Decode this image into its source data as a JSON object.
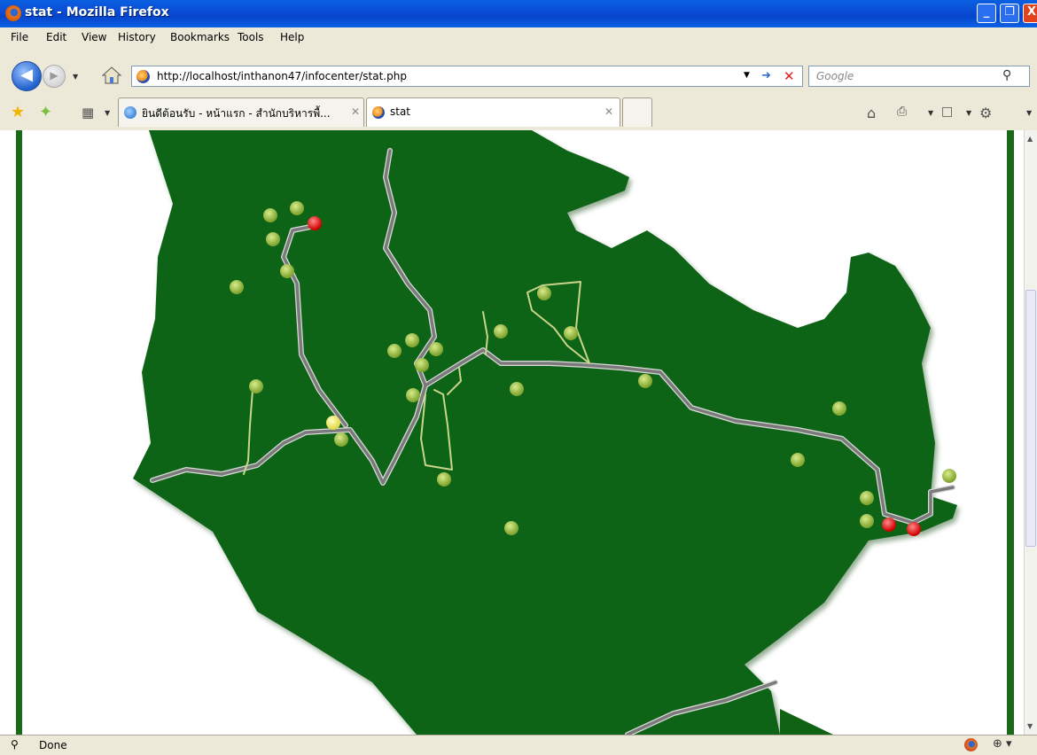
{
  "window": {
    "title": "stat - Mozilla Firefox",
    "minimize": "_",
    "maximize": "❐",
    "close": "X"
  },
  "menu": [
    "File",
    "Edit",
    "View",
    "History",
    "Bookmarks",
    "Tools",
    "Help"
  ],
  "nav": {
    "url": "http://localhost/inthanon47/infocenter/stat.php",
    "search_placeholder": "Google"
  },
  "tabs": [
    {
      "label": "ยินดีต้อนรับ - หน้าแรก - สำนักบริหารพื้...",
      "active": false
    },
    {
      "label": "stat",
      "active": true
    }
  ],
  "status": {
    "text": "Done"
  },
  "colors": {
    "land": "#0f6312",
    "road": "#8a8a8a",
    "trail": "#c9d58a",
    "marker_default": "#8fb63c",
    "marker_alert": "#e81010",
    "marker_highlight": "#f5f060"
  },
  "markers": [
    {
      "type": "default"
    },
    {
      "type": "default"
    },
    {
      "type": "alert"
    },
    {
      "type": "default"
    },
    {
      "type": "default"
    },
    {
      "type": "default"
    },
    {
      "type": "default"
    },
    {
      "type": "default"
    },
    {
      "type": "default"
    },
    {
      "type": "default"
    },
    {
      "type": "default"
    },
    {
      "type": "default"
    },
    {
      "type": "default"
    },
    {
      "type": "default"
    },
    {
      "type": "default"
    },
    {
      "type": "highlight"
    },
    {
      "type": "default"
    },
    {
      "type": "default"
    },
    {
      "type": "default"
    },
    {
      "type": "default"
    },
    {
      "type": "default"
    },
    {
      "type": "default"
    },
    {
      "type": "default"
    },
    {
      "type": "default"
    },
    {
      "type": "alert"
    },
    {
      "type": "alert"
    },
    {
      "type": "default"
    },
    {
      "type": "default"
    }
  ]
}
